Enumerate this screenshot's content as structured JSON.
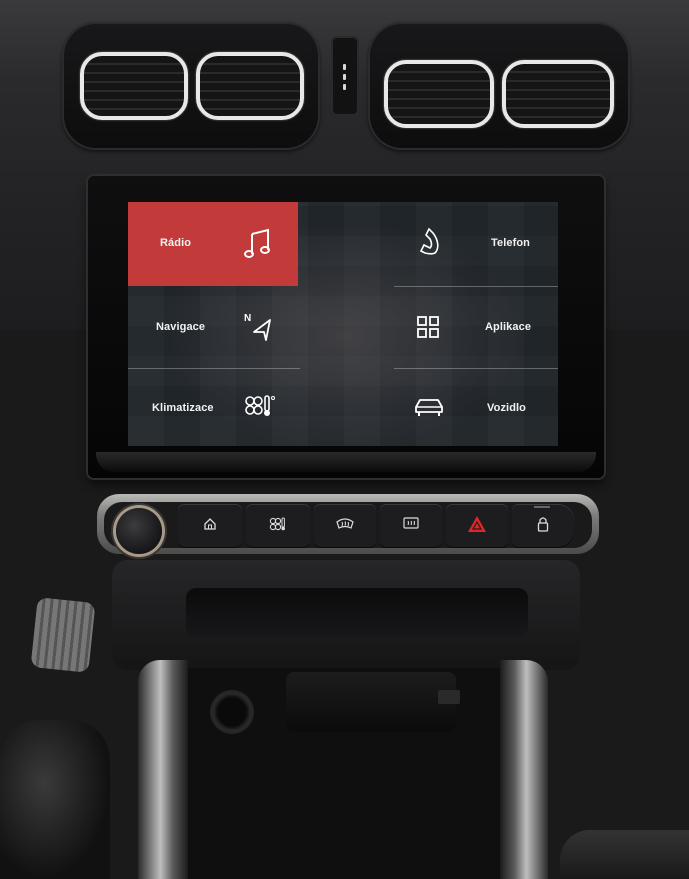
{
  "screen": {
    "tiles": [
      {
        "id": "radio",
        "label": "Rádio",
        "icon": "music-note-icon",
        "active": true
      },
      {
        "id": "telefon",
        "label": "Telefon",
        "icon": "phone-icon",
        "active": false
      },
      {
        "id": "navigace",
        "label": "Navigace",
        "icon": "navigation-arrow-icon",
        "active": false
      },
      {
        "id": "aplikace",
        "label": "Aplikace",
        "icon": "apps-grid-icon",
        "active": false
      },
      {
        "id": "klimatizace",
        "label": "Klimatizace",
        "icon": "fan-temperature-icon",
        "active": false
      },
      {
        "id": "vozidlo",
        "label": "Vozidlo",
        "icon": "car-icon",
        "active": false
      }
    ],
    "active_color": "#c23a3a"
  },
  "hard_buttons": [
    {
      "id": "home",
      "icon": "home-icon"
    },
    {
      "id": "climate",
      "icon": "fan-icon"
    },
    {
      "id": "front-defrost",
      "icon": "front-defrost-icon"
    },
    {
      "id": "rear-defrost",
      "icon": "rear-defrost-icon"
    },
    {
      "id": "hazard",
      "icon": "hazard-warning-icon",
      "color": "#e0262a"
    },
    {
      "id": "lock",
      "icon": "door-lock-icon"
    }
  ]
}
